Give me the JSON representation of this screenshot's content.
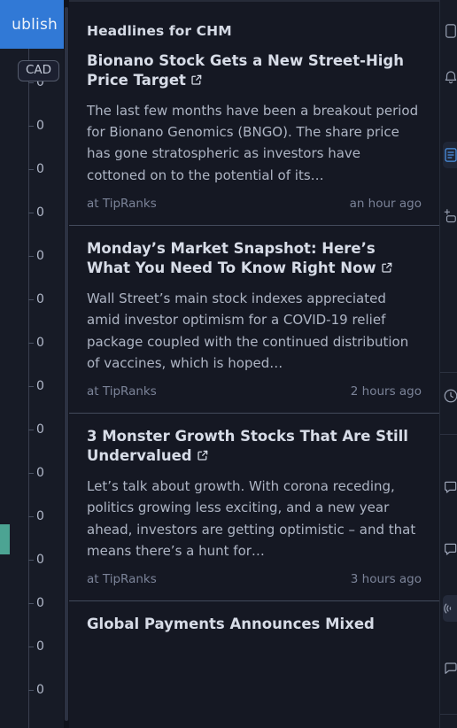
{
  "chart_panel": {
    "publish_button_label": "ublish",
    "currency_badge": "CAD",
    "price_marker_color": "#4ca493",
    "axis": {
      "tick_labels": [
        "0",
        "0",
        "0",
        "0",
        "0",
        "0",
        "0",
        "0",
        "0",
        "0",
        "0",
        "0",
        "0",
        "0",
        "0"
      ]
    }
  },
  "news": {
    "header": "Headlines for CHM",
    "external_link_icon": "external-link-icon",
    "items": [
      {
        "title": "Bionano Stock Gets a New Street-High Price Target",
        "summary": "The last few months have been a breakout period for Bionano Genomics (BNGO). The share price has gone stratospheric as investors have cottoned on to the potential of its…",
        "source": "at TipRanks",
        "time": "an hour ago"
      },
      {
        "title": "Monday’s Market Snapshot: Here’s What You Need To Know Right Now",
        "summary": "Wall Street’s main stock indexes appreciated amid investor optimism for a COVID-19 relief package coupled with the continued distribution of vaccines, which is hoped…",
        "source": "at TipRanks",
        "time": "2 hours ago"
      },
      {
        "title": "3 Monster Growth Stocks That Are Still Undervalued",
        "summary": "Let’s talk about growth. With corona receding, politics growing less exciting, and a new year ahead, investors are getting optimistic – and that means there’s a hunt for…",
        "source": "at TipRanks",
        "time": "3 hours ago"
      },
      {
        "title": "Global Payments Announces Mixed",
        "summary": "",
        "source": "",
        "time": ""
      }
    ]
  },
  "right_toolbar": {
    "items": [
      {
        "name": "watchlist-icon"
      },
      {
        "name": "alerts-icon"
      },
      {
        "name": "data-window-icon",
        "state": "active"
      },
      {
        "name": "hotlists-icon"
      },
      {
        "name": "calendar-icon"
      },
      {
        "name": "news-icon"
      },
      {
        "name": "ideas-icon"
      },
      {
        "name": "stream-icon",
        "state": "soft"
      },
      {
        "name": "chat-icon"
      }
    ]
  }
}
